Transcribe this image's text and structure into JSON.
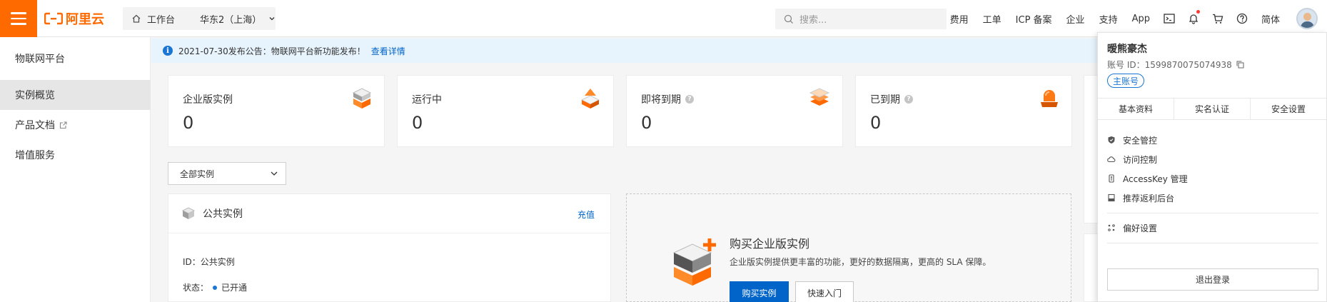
{
  "brand": {
    "logo_text": "阿里云",
    "accent": "#ff6a00"
  },
  "topbar": {
    "workbench": "工作台",
    "region": "华东2（上海）",
    "search_placeholder": "搜索...",
    "links": [
      "费用",
      "工单",
      "ICP 备案",
      "企业",
      "支持",
      "App"
    ],
    "lang": "简体"
  },
  "sidebar": {
    "title": "物联网平台",
    "items": [
      {
        "label": "实例概览",
        "active": true
      },
      {
        "label": "产品文档",
        "active": false
      },
      {
        "label": "增值服务",
        "active": false
      }
    ]
  },
  "notice": {
    "text": "2021-07-30发布公告：物联网平台新功能发布！",
    "link": "查看详情"
  },
  "stats": [
    {
      "label": "企业版实例",
      "value": "0",
      "icon": "server-stack-icon"
    },
    {
      "label": "运行中",
      "value": "0",
      "icon": "running-icon"
    },
    {
      "label": "即将到期",
      "value": "0",
      "icon": "layers-icon"
    },
    {
      "label": "已到期",
      "value": "0",
      "icon": "alarm-light-icon"
    }
  ],
  "filter": {
    "selected": "全部实例"
  },
  "public_instance": {
    "title": "公共实例",
    "action": "充值",
    "id_label": "ID：",
    "id_value": "公共实例",
    "status_label": "状态：",
    "status_value": "已开通"
  },
  "buy_panel": {
    "title": "购买企业版实例",
    "desc": "企业版实例提供更丰富的功能，更好的数据隔离，更高的 SLA 保障。",
    "primary": "购买实例",
    "secondary": "快速入门"
  },
  "user_menu": {
    "name": "暧熊豪杰",
    "account_label": "账号 ID：",
    "account_id": "1599870075074938",
    "badge": "主账号",
    "tabs": [
      "基本资料",
      "实名认证",
      "安全设置"
    ],
    "items": [
      "安全管控",
      "访问控制",
      "AccessKey 管理",
      "推荐返利后台"
    ],
    "preferences": "偏好设置",
    "logout": "退出登录"
  }
}
